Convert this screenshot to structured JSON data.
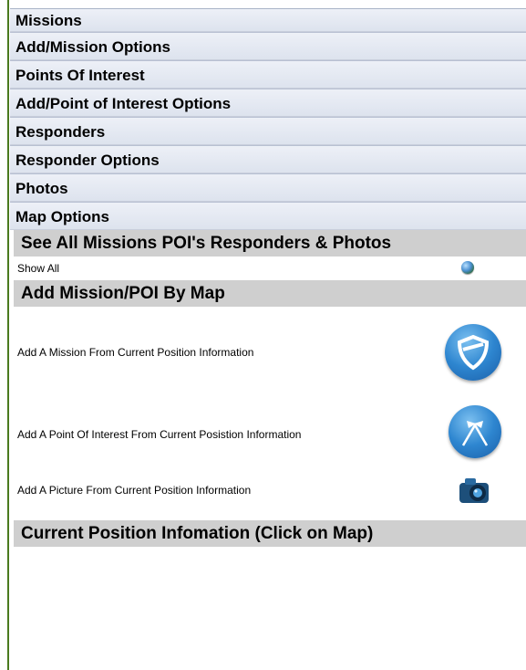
{
  "accordion": {
    "items": [
      {
        "label": "Missions"
      },
      {
        "label": "Add/Mission Options"
      },
      {
        "label": "Points Of Interest"
      },
      {
        "label": "Add/Point of Interest Options"
      },
      {
        "label": "Responders"
      },
      {
        "label": "Responder Options"
      },
      {
        "label": "Photos"
      },
      {
        "label": "Map Options"
      }
    ]
  },
  "map_options": {
    "see_all_title": "See All Missions POI's Responders & Photos",
    "show_all_label": "Show All",
    "add_by_map_title": "Add Mission/POI By Map",
    "add_mission_label": "Add A Mission From Current Position Information",
    "add_poi_label": "Add A Point Of Interest From Current Posistion Information",
    "add_picture_label": "Add A Picture From Current Position Information",
    "current_position_title": "Current Position Infomation (Click on Map)"
  },
  "icons": {
    "show_all": "globe-icon",
    "add_mission": "shield-icon",
    "add_poi": "flags-icon",
    "add_picture": "camera-icon"
  }
}
